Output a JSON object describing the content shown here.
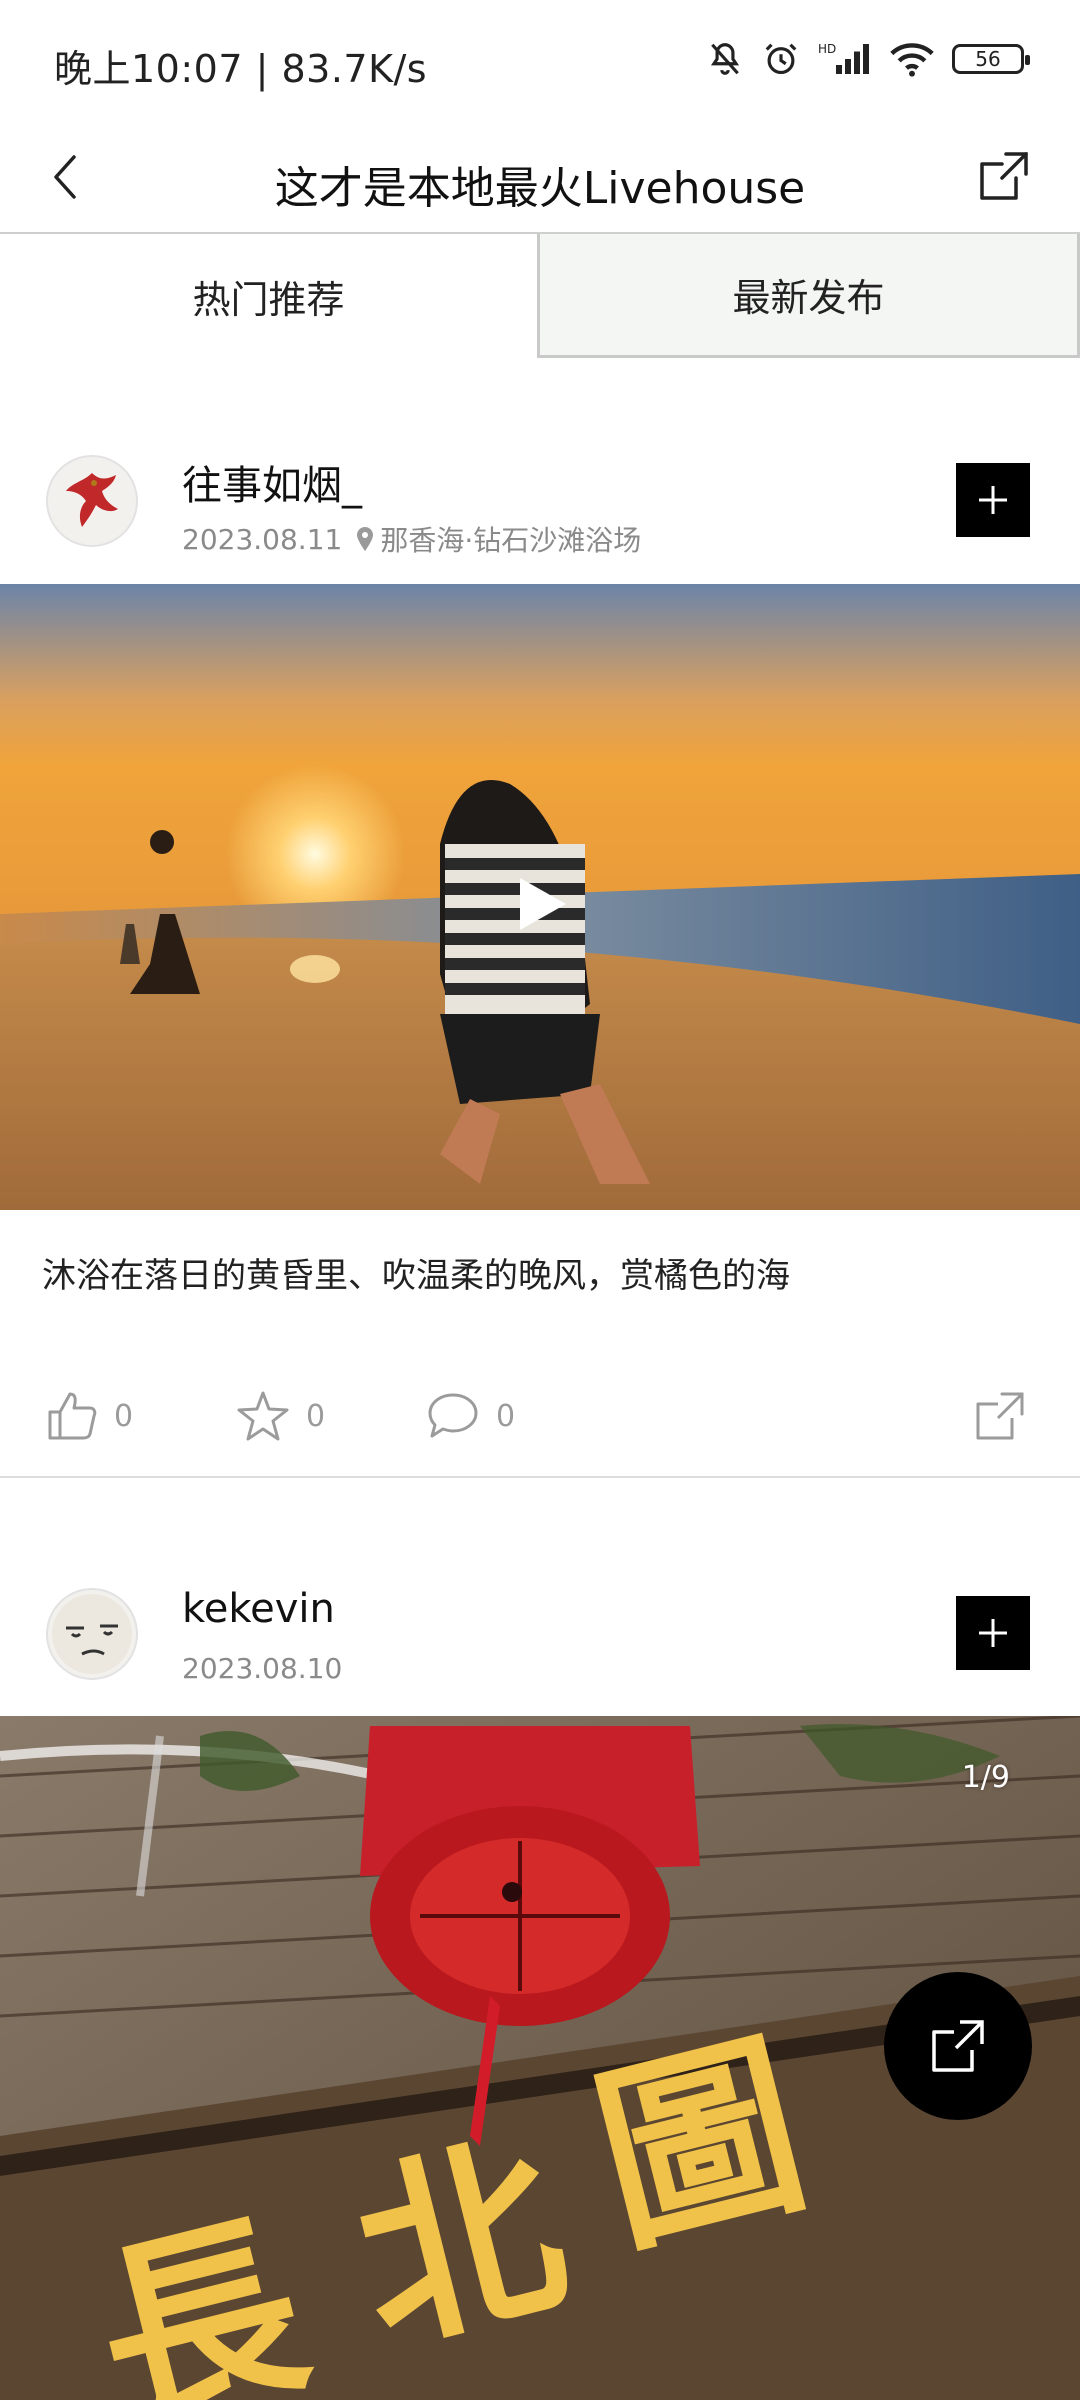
{
  "status_bar": {
    "left_text": "晚上10:07 | 83.7K/s",
    "battery": "56",
    "icons": [
      "bell-muted-icon",
      "alarm-icon",
      "hd-signal-icon",
      "wifi-icon",
      "battery-icon"
    ]
  },
  "header": {
    "title": "这才是本地最火Livehouse",
    "back_icon": "chevron-left-icon",
    "share_icon": "share-icon"
  },
  "tabs": [
    {
      "label": "热门推荐",
      "active": true
    },
    {
      "label": "最新发布",
      "active": false
    }
  ],
  "posts": [
    {
      "username": "往事如烟_",
      "date": "2023.08.11",
      "location": "那香海·钻石沙滩浴场",
      "media_type": "video",
      "caption": "沐浴在落日的黄昏里、吹温柔的晚风，赏橘色的海",
      "likes": "0",
      "favorites": "0",
      "comments": "0"
    },
    {
      "username": "kekevin",
      "date": "2023.08.10",
      "media_type": "image",
      "image_counter": "1/9"
    }
  ],
  "colors": {
    "accent": "#000000",
    "muted_text": "#8a8a8a",
    "divider": "#dcdcdc",
    "inactive_tab_bg": "#f4f6f4"
  }
}
